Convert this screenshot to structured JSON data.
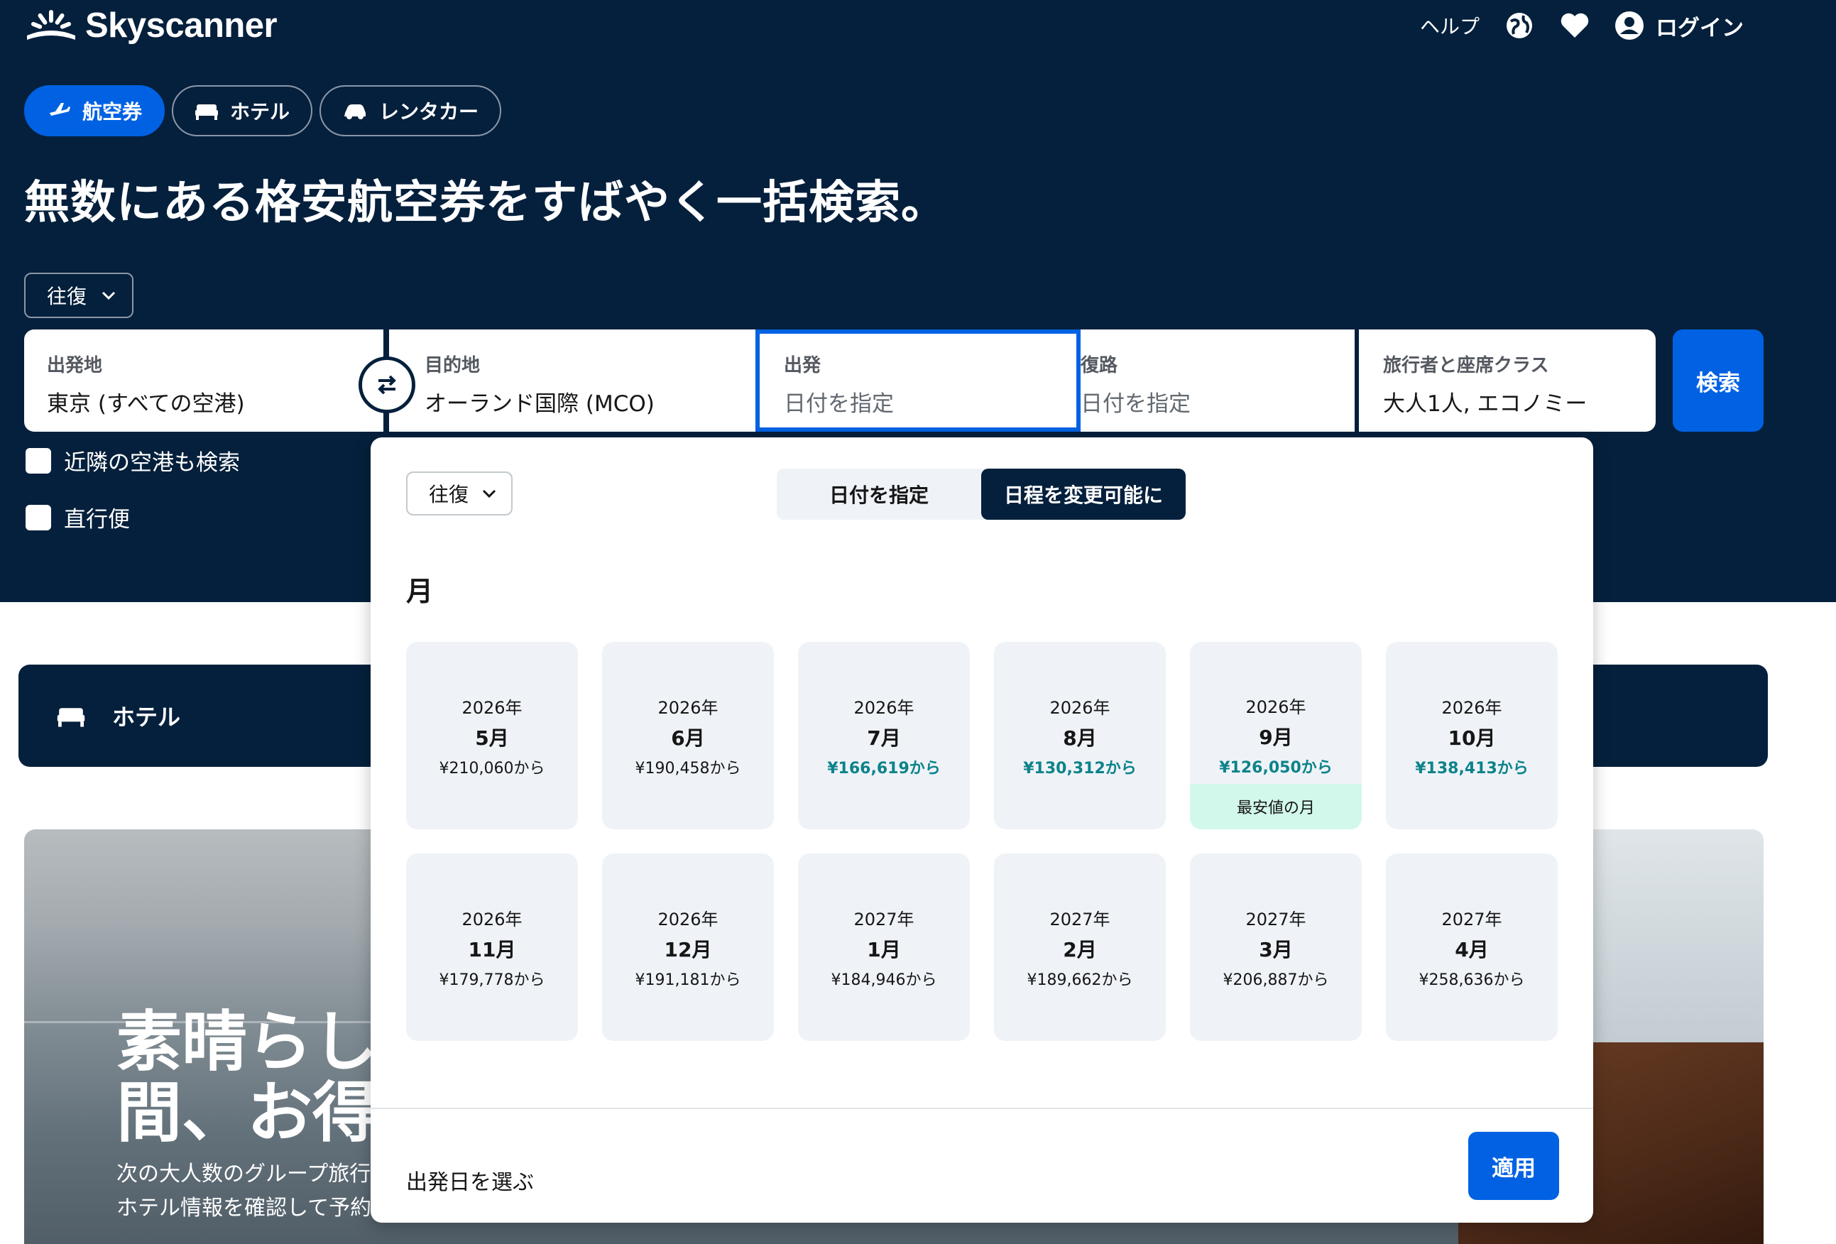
{
  "header": {
    "logo_text": "Skyscanner",
    "help": "ヘルプ",
    "login": "ログイン",
    "icons": [
      "globe-icon",
      "heart-icon",
      "account-icon"
    ]
  },
  "tabs": [
    {
      "label": "航空券",
      "icon": "plane-icon",
      "active": true
    },
    {
      "label": "ホテル",
      "icon": "bed-icon",
      "active": false
    },
    {
      "label": "レンタカー",
      "icon": "car-icon",
      "active": false
    }
  ],
  "headline": "無数にある格安航空券をすばやく一括検索。",
  "trip_type": "往復",
  "search": {
    "origin_label": "出発地",
    "origin_value": "東京 (すべての空港)",
    "destination_label": "目的地",
    "destination_value": "オーランド国際 (MCO)",
    "depart_label": "出発",
    "depart_placeholder": "日付を指定",
    "return_label": "復路",
    "return_placeholder": "日付を指定",
    "travellers_label": "旅行者と座席クラス",
    "travellers_value": "大人1人, エコノミー",
    "search_button": "検索"
  },
  "checkboxes": {
    "nearby": "近隣の空港も検索",
    "direct": "直行便"
  },
  "hotel_banner": "ホテル",
  "promo": {
    "title": "素晴らし\n間、お得",
    "subtitle": "次の大人数のグループ旅行\nホテル情報を確認して予約"
  },
  "datepicker": {
    "trip_type": "往復",
    "seg_specific": "日付を指定",
    "seg_flexible": "日程を変更可能に",
    "section_title": "月",
    "months": [
      {
        "year": "2026年",
        "month": "5月",
        "price": "¥210,060から",
        "cheap": false
      },
      {
        "year": "2026年",
        "month": "6月",
        "price": "¥190,458から",
        "cheap": false
      },
      {
        "year": "2026年",
        "month": "7月",
        "price": "¥166,619から",
        "cheap": true
      },
      {
        "year": "2026年",
        "month": "8月",
        "price": "¥130,312から",
        "cheap": true
      },
      {
        "year": "2026年",
        "month": "9月",
        "price": "¥126,050から",
        "cheap": true,
        "badge": "最安値の月"
      },
      {
        "year": "2026年",
        "month": "10月",
        "price": "¥138,413から",
        "cheap": true
      },
      {
        "year": "2026年",
        "month": "11月",
        "price": "¥179,778から",
        "cheap": false
      },
      {
        "year": "2026年",
        "month": "12月",
        "price": "¥191,181から",
        "cheap": false
      },
      {
        "year": "2027年",
        "month": "1月",
        "price": "¥184,946から",
        "cheap": false
      },
      {
        "year": "2027年",
        "month": "2月",
        "price": "¥189,662から",
        "cheap": false
      },
      {
        "year": "2027年",
        "month": "3月",
        "price": "¥206,887から",
        "cheap": false
      },
      {
        "year": "2027年",
        "month": "4月",
        "price": "¥258,636から",
        "cheap": false
      }
    ],
    "footer_text": "出発日を選ぶ",
    "apply_button": "適用"
  },
  "colors": {
    "navy": "#05203c",
    "brand_blue": "#0062e3",
    "cheap_green": "#0c838a",
    "card_bg": "#eff3f8",
    "badge_bg": "#d2f7eb"
  }
}
